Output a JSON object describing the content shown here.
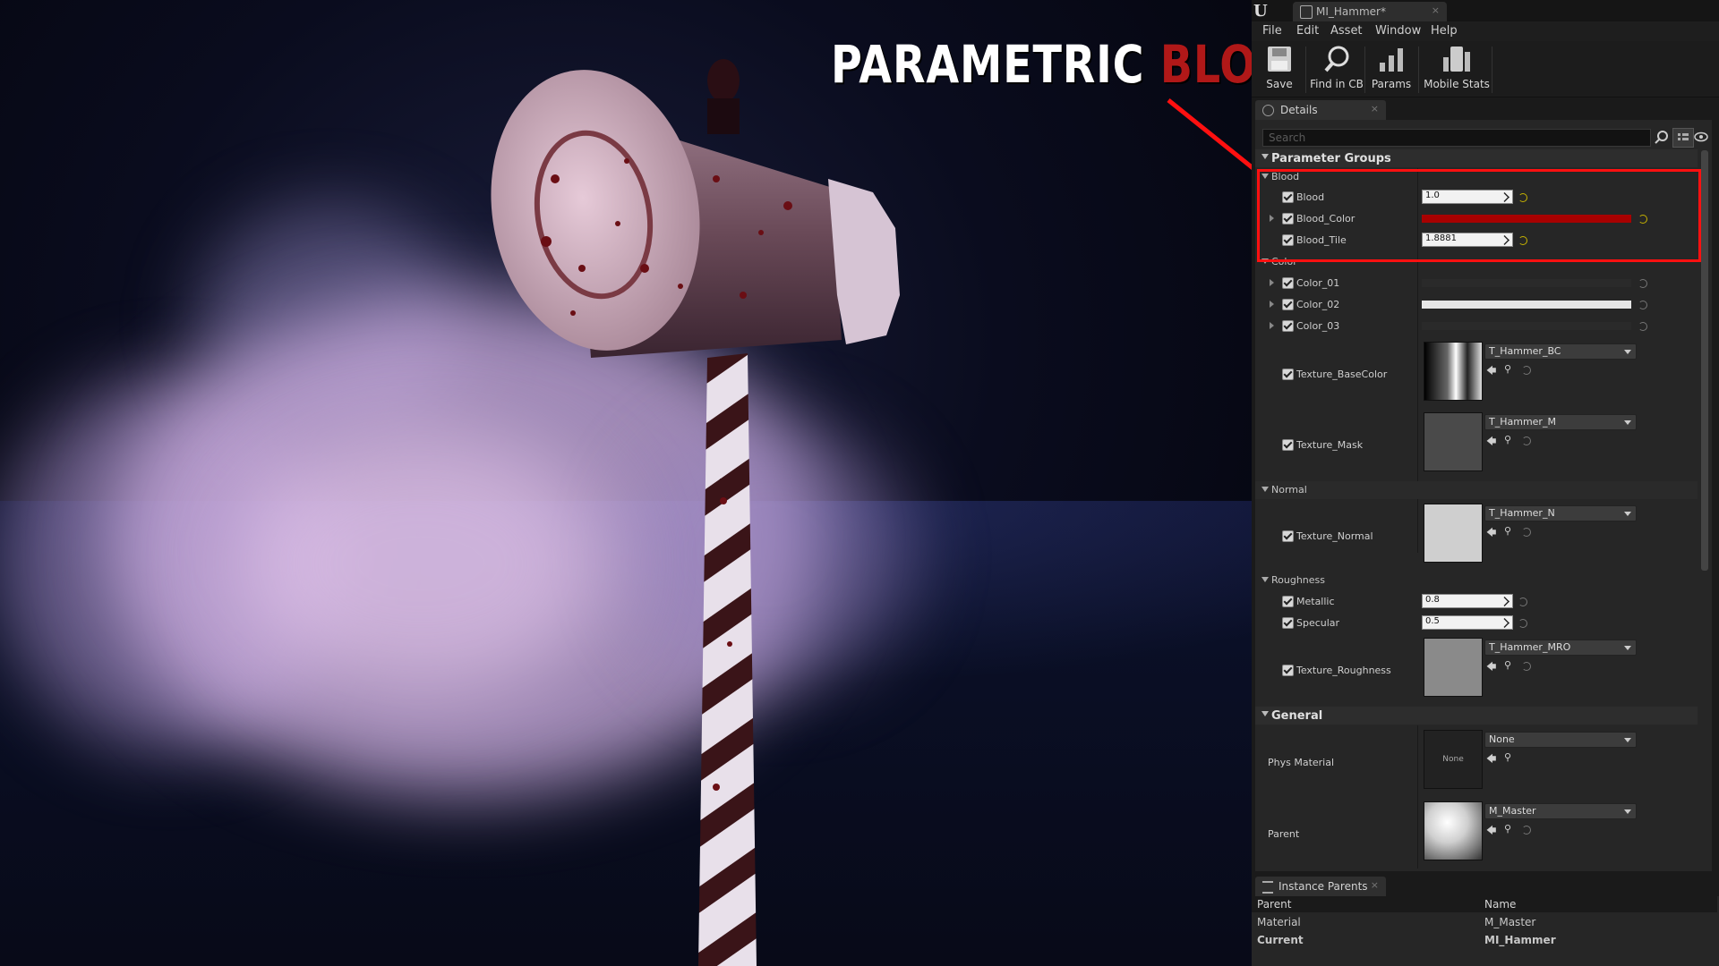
{
  "headline": {
    "word1": "PARAMETRIC",
    "word2": "BLOOD"
  },
  "titlebar": {
    "logo": "U",
    "tab_label": "MI_Hammer*",
    "close": "×"
  },
  "menu": [
    "File",
    "Edit",
    "Asset",
    "Window",
    "Help"
  ],
  "toolbar": [
    {
      "label": "Save",
      "icon": "save-icon"
    },
    {
      "label": "Find in CB",
      "icon": "search-icon"
    },
    {
      "label": "Params",
      "icon": "params-icon"
    },
    {
      "label": "Mobile Stats",
      "icon": "mobile-stats-icon"
    }
  ],
  "details": {
    "tab_label": "Details",
    "close": "×",
    "search_placeholder": "Search",
    "parameter_groups_label": "Parameter Groups",
    "blood_group": "Blood",
    "blood": {
      "label": "Blood",
      "value": "1.0"
    },
    "blood_color": {
      "label": "Blood_Color",
      "color": "#a80000"
    },
    "blood_tile": {
      "label": "Blood_Tile",
      "value": "1.8881"
    },
    "color_group": "Color",
    "color_01": {
      "label": "Color_01",
      "color": "#2a2a2a"
    },
    "color_02": {
      "label": "Color_02",
      "color": "#e6e6e6"
    },
    "color_03": {
      "label": "Color_03",
      "color": "#2a2a2a"
    },
    "texture_basecolor": {
      "label": "Texture_BaseColor",
      "value": "T_Hammer_BC"
    },
    "texture_mask": {
      "label": "Texture_Mask",
      "value": "T_Hammer_M"
    },
    "normal_group": "Normal",
    "texture_normal": {
      "label": "Texture_Normal",
      "value": "T_Hammer_N"
    },
    "roughness_group": "Roughness",
    "metallic": {
      "label": "Metallic",
      "value": "0.8"
    },
    "specular": {
      "label": "Specular",
      "value": "0.5"
    },
    "texture_roughness": {
      "label": "Texture_Roughness",
      "value": "T_Hammer_MRO"
    },
    "general_label": "General",
    "phys_material": {
      "label": "Phys Material",
      "value": "None",
      "thumb_text": "None"
    },
    "parent": {
      "label": "Parent",
      "value": "M_Master"
    }
  },
  "instance_parents": {
    "tab_label": "Instance Parents",
    "close": "×",
    "headers": [
      "Parent",
      "Name"
    ],
    "rows": [
      {
        "parent": "Material",
        "name": "M_Master"
      },
      {
        "parent": "Current",
        "name": "MI_Hammer"
      }
    ]
  },
  "colors": {
    "blood_red": "#b01818",
    "highlight_box": "#ff1010",
    "panel_bg": "#262626"
  }
}
